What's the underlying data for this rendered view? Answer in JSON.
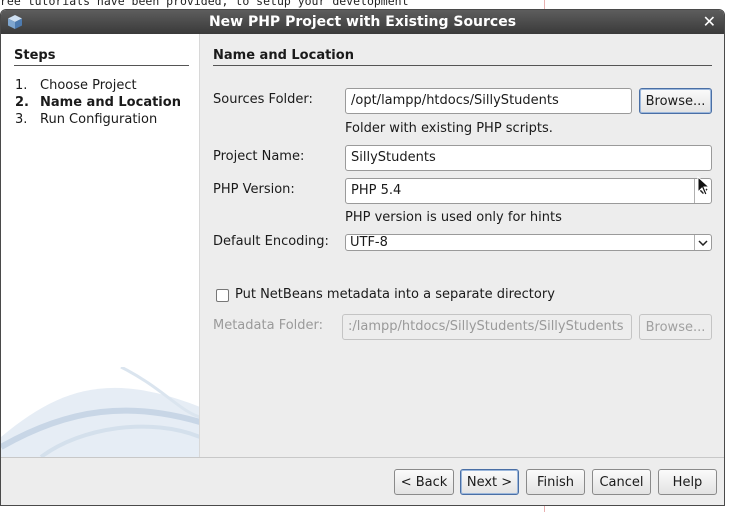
{
  "background": {
    "text": "ree tutorials have been provided, to setup your development"
  },
  "dialog": {
    "title": "New PHP Project with Existing Sources",
    "steps": {
      "title": "Steps",
      "items": [
        {
          "num": "1.",
          "label": "Choose Project",
          "active": false
        },
        {
          "num": "2.",
          "label": "Name and Location",
          "active": true
        },
        {
          "num": "3.",
          "label": "Run Configuration",
          "active": false
        }
      ]
    },
    "section_title": "Name and Location",
    "sources_folder": {
      "label": "Sources Folder:",
      "value": "/opt/lampp/htdocs/SillyStudents",
      "hint": "Folder with existing PHP scripts.",
      "browse": "Browse..."
    },
    "project_name": {
      "label": "Project Name:",
      "value": "SillyStudents"
    },
    "php_version": {
      "label": "PHP Version:",
      "value": "PHP 5.4",
      "hint": "PHP version is used only for hints"
    },
    "default_encoding": {
      "label": "Default Encoding:",
      "value": "UTF-8"
    },
    "metadata_checkbox": {
      "label": "Put NetBeans metadata into a separate directory",
      "checked": false
    },
    "metadata_folder": {
      "label": "Metadata Folder:",
      "value": ":/lampp/htdocs/SillyStudents/SillyStudents",
      "browse": "Browse..."
    },
    "buttons": {
      "back": "< Back",
      "next": "Next >",
      "finish": "Finish",
      "cancel": "Cancel",
      "help": "Help"
    }
  },
  "colors": {
    "titlebar": "#4a4a4a",
    "window_bg": "#ededed",
    "focus": "#4a6fa5"
  },
  "icons": [
    "app-cube-icon",
    "close-icon",
    "dropdown-arrow-icon",
    "mouse-cursor-icon"
  ]
}
